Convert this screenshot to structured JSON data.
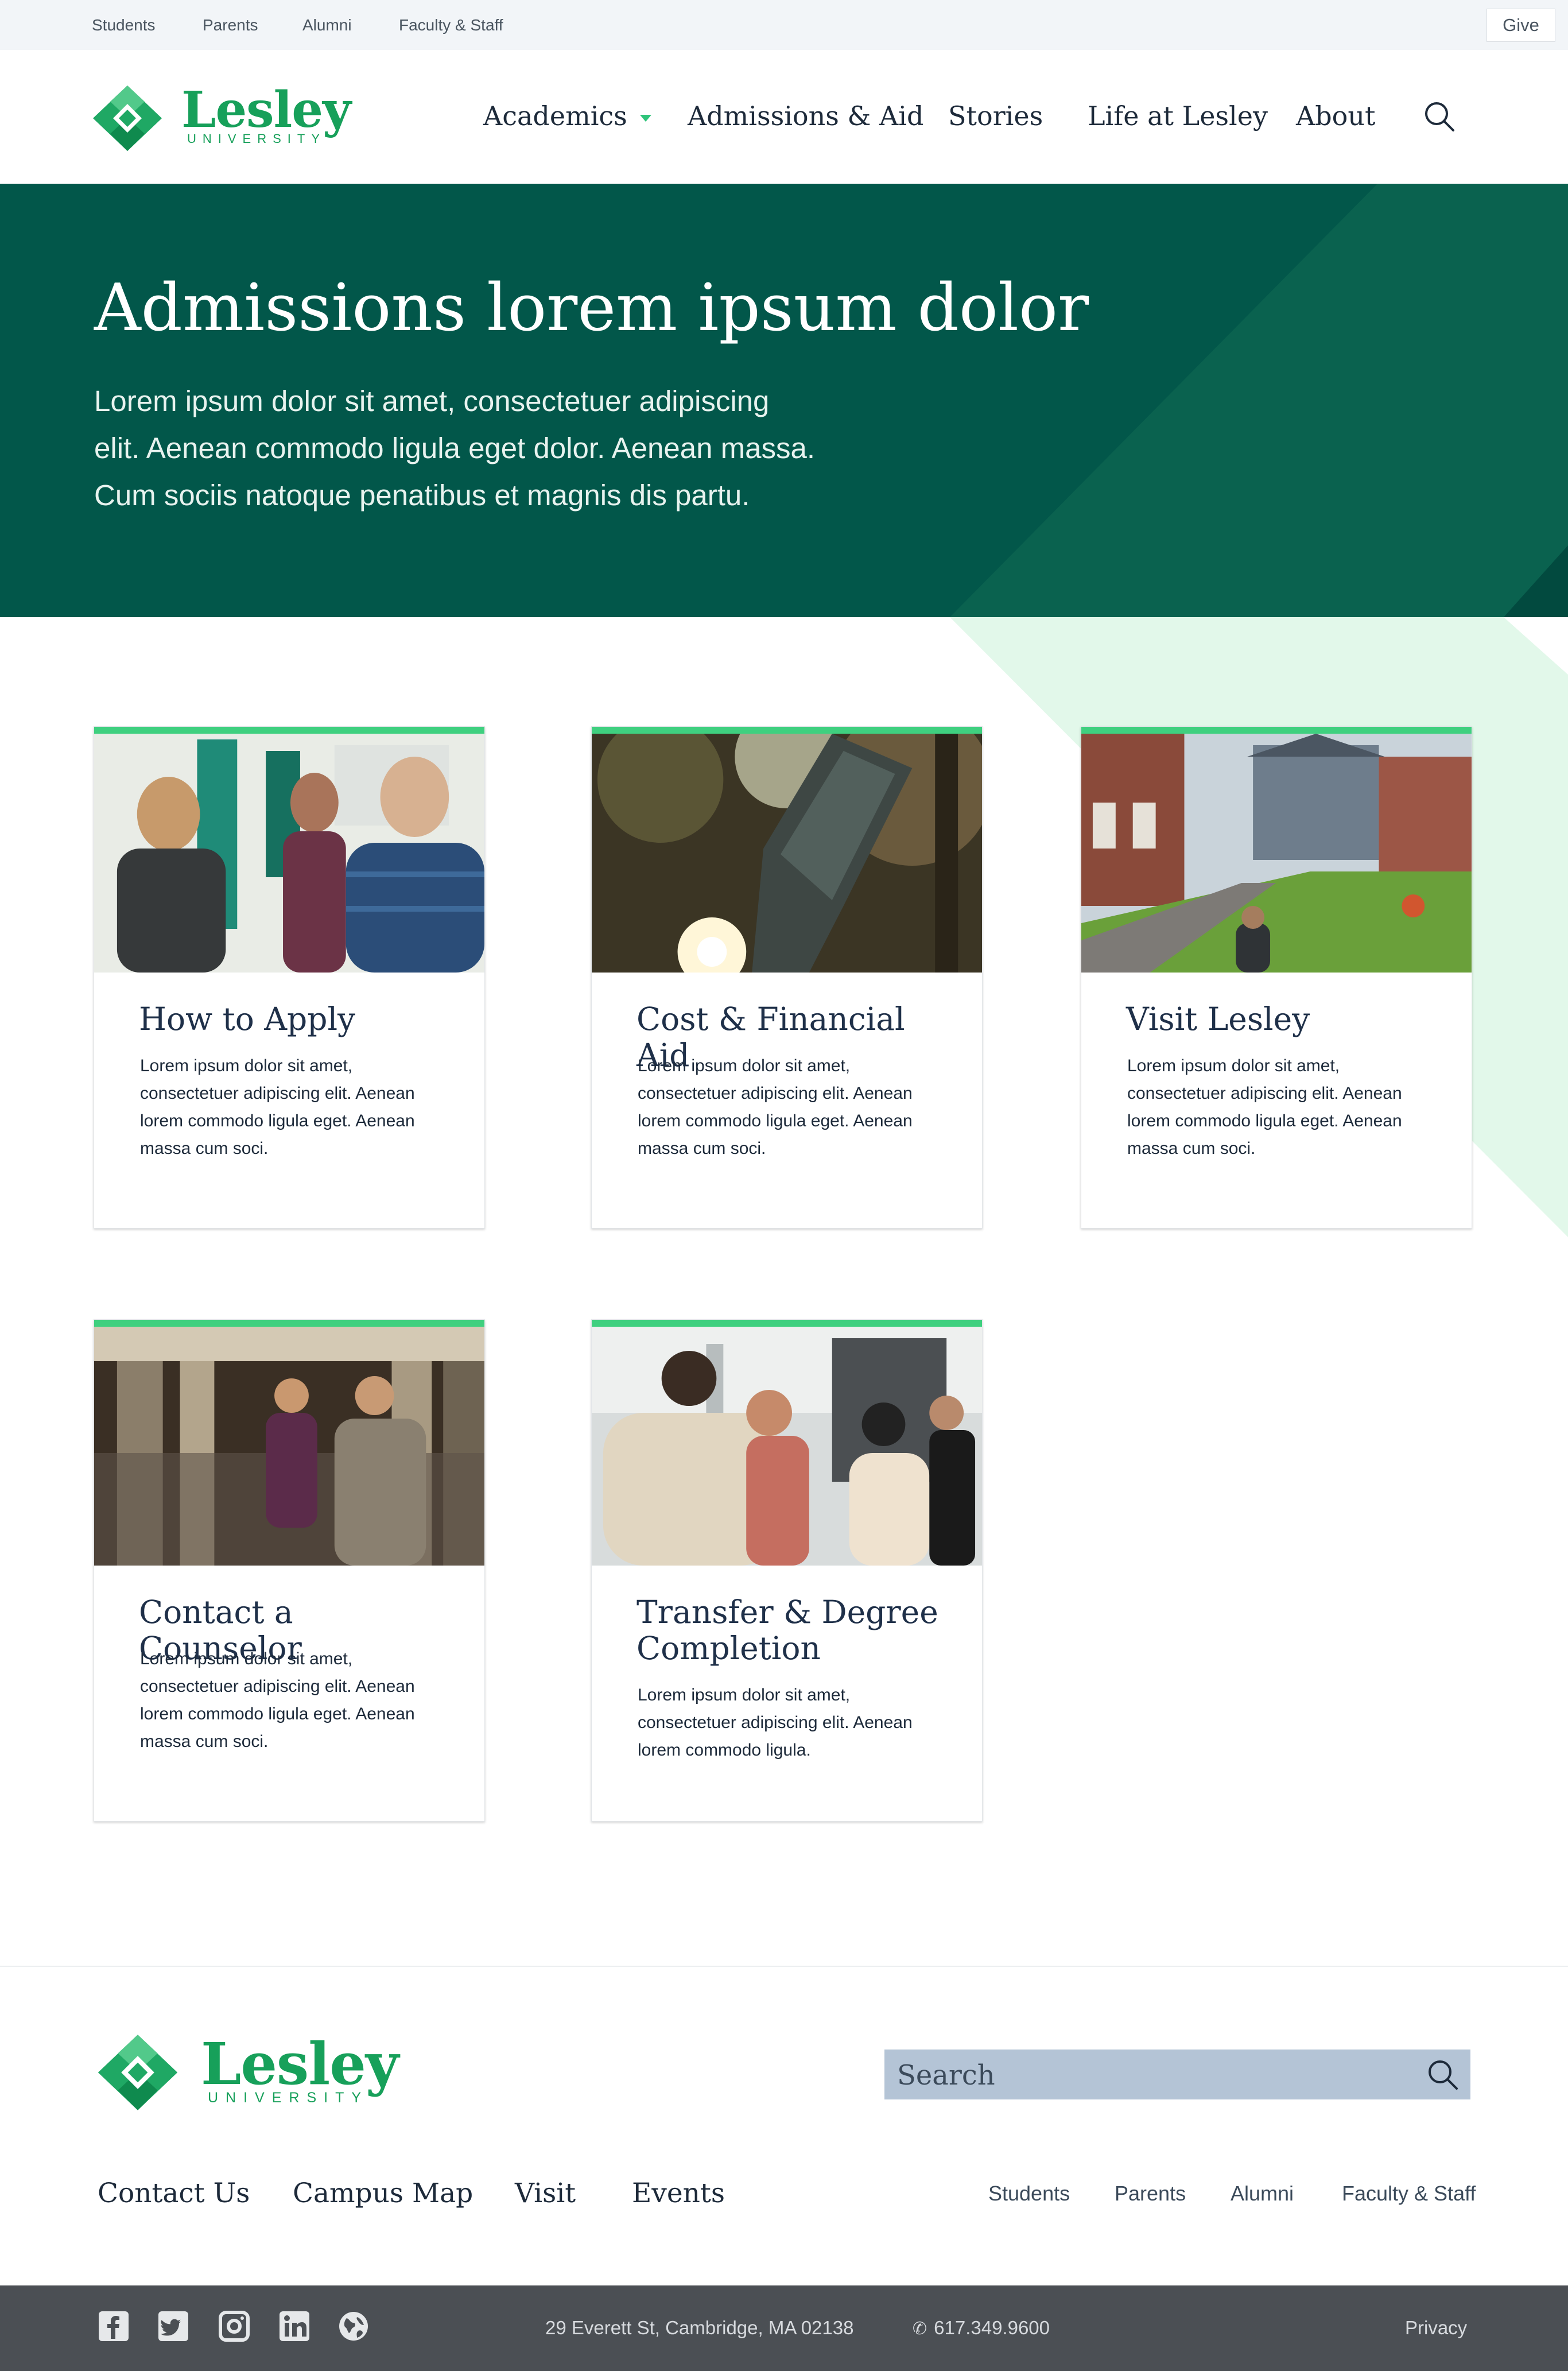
{
  "utility_bar": {
    "links": [
      "Students",
      "Parents",
      "Alumni",
      "Faculty & Staff"
    ],
    "give_label": "Give"
  },
  "brand": {
    "name": "Lesley",
    "sub": "UNIVERSITY",
    "colors": {
      "green": "#17a05a",
      "dark_green": "#02574a",
      "accent_green": "#3fd07f",
      "mint": "#e2f8ea"
    }
  },
  "nav": {
    "items": [
      "Academics",
      "Admissions & Aid",
      "Stories",
      "Life at Lesley",
      "About"
    ],
    "active": "Admissions & Aid",
    "search_icon": "search-icon",
    "dropdown_icon": "caret-down-icon"
  },
  "hero": {
    "title": "Admissions lorem ipsum dolor",
    "lines": [
      "Lorem ipsum dolor sit amet, consectetuer adipiscing",
      "elit. Aenean commodo ligula eget dolor. Aenean massa.",
      "Cum sociis natoque penatibus et magnis dis partu."
    ]
  },
  "cards": [
    {
      "title": "How to Apply",
      "text": "Lorem ipsum dolor sit amet, consectetuer adipiscing elit. Aenean lorem commodo ligula eget. Aenean massa cum soci."
    },
    {
      "title": "Cost & Financial Aid",
      "text": "Lorem ipsum dolor sit amet, consectetuer adipiscing elit. Aenean lorem commodo ligula eget. Aenean massa cum soci."
    },
    {
      "title": "Visit Lesley",
      "text": "Lorem ipsum dolor sit amet, consectetuer adipiscing elit. Aenean lorem commodo ligula eget. Aenean massa cum soci."
    },
    {
      "title": "Contact a Counselor",
      "text": "Lorem ipsum dolor sit amet, consectetuer adipiscing elit. Aenean lorem commodo ligula eget. Aenean massa cum soci."
    },
    {
      "title": "Transfer & Degree Completion",
      "text": "Lorem ipsum dolor sit amet, consectetuer adipiscing elit. Aenean lorem commodo ligula."
    }
  ],
  "footer": {
    "search_placeholder": "Search",
    "links": [
      "Contact Us",
      "Campus Map",
      "Visit",
      "Events"
    ],
    "audience_links": [
      "Students",
      "Parents",
      "Alumni",
      "Faculty & Staff"
    ]
  },
  "bottom_bar": {
    "social_icons": [
      "facebook-icon",
      "twitter-icon",
      "instagram-icon",
      "linkedin-icon",
      "globe-icon"
    ],
    "address": "29 Everett St, Cambridge, MA 02138",
    "phone": "617.349.9600",
    "privacy": "Privacy"
  }
}
